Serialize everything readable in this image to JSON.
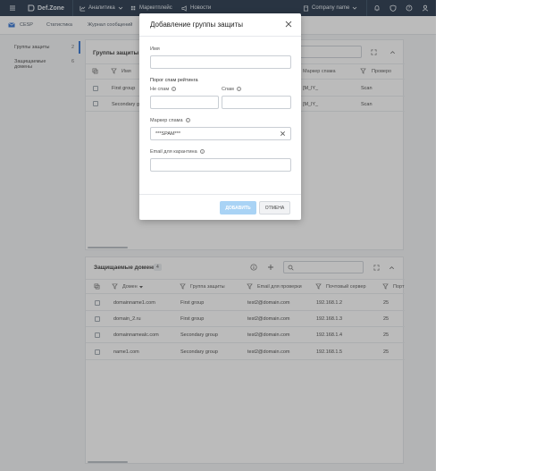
{
  "topbar": {
    "logo": "Def.Zone",
    "analytics": "Аналитика",
    "marketplace": "Маркетплейс",
    "news": "Новости",
    "company": "Company name"
  },
  "subnav": {
    "items": [
      "CESP",
      "Статистика",
      "Журнал сообщений"
    ]
  },
  "sidebar": {
    "items": [
      {
        "label": "Группы защиты",
        "count": "2"
      },
      {
        "label": "Защищаемые домены",
        "count": "6"
      }
    ]
  },
  "groups_panel": {
    "title": "Группы защиты",
    "columns": [
      "Имя",
      "Маркер спама",
      "Проверо"
    ],
    "rows": [
      {
        "name": "First group",
        "marker": "[M_lY_",
        "check": "Scan"
      },
      {
        "name": "Secondary gro",
        "marker": "[M_lY_",
        "check": "Scan"
      }
    ]
  },
  "domains_panel": {
    "title": "Защищаемые домены",
    "count": "4",
    "columns": [
      "Домен",
      "Группа защиты",
      "Email для проверки",
      "Почтовый сервер",
      "Порт"
    ],
    "rows": [
      {
        "domain": "domainname1.com",
        "group": "First group",
        "email": "test2@domain.com",
        "server": "192.168.1.2",
        "port": "25"
      },
      {
        "domain": "domain_2.ru",
        "group": "First group",
        "email": "test2@domain.com",
        "server": "192.168.1.3",
        "port": "25"
      },
      {
        "domain": "domainnamealc.com",
        "group": "Secondary group",
        "email": "test2@domain.com",
        "server": "192.168.1.4",
        "port": "25"
      },
      {
        "domain": "name1.com",
        "group": "Secondary group",
        "email": "test2@domain.com",
        "server": "192.168.1.5",
        "port": "25"
      }
    ]
  },
  "modal": {
    "title": "Добавление группы защиты",
    "name_label": "Имя",
    "name_value": "",
    "threshold_label": "Порог спам рейтинга",
    "not_spam_label": "Не спам",
    "spam_label": "Спам",
    "marker_label": "Маркер спама",
    "marker_value": "***SPAM***",
    "quarantine_label": "Email для карантина",
    "quarantine_value": "",
    "add_button": "ДОБАВИТЬ",
    "cancel_button": "ОТМЕНА"
  },
  "colors": {
    "topbar": "#1f3146",
    "accent": "#2c6fd1",
    "primary_disabled": "#a9d3f5"
  }
}
